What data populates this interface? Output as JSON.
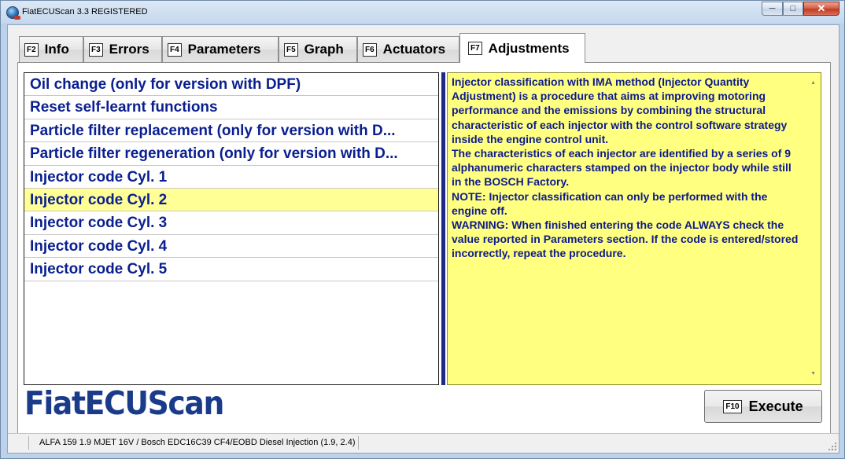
{
  "window": {
    "title": "FiatECUScan 3.3 REGISTERED",
    "caption_buttons": {
      "minimize": "─",
      "maximize": "□",
      "close": "✕"
    }
  },
  "tabs": [
    {
      "key": "F2",
      "label": "Info"
    },
    {
      "key": "F3",
      "label": "Errors"
    },
    {
      "key": "F4",
      "label": "Parameters"
    },
    {
      "key": "F5",
      "label": "Graph"
    },
    {
      "key": "F6",
      "label": "Actuators"
    },
    {
      "key": "F7",
      "label": "Adjustments",
      "active": true
    }
  ],
  "adjustments": {
    "items": [
      "Oil change (only for version with DPF)",
      "Reset self-learnt functions",
      "Particle filter replacement (only for version with D...",
      "Particle filter regeneration (only for version with D...",
      "Injector code Cyl. 1",
      "Injector code Cyl. 2",
      "Injector code Cyl. 3",
      "Injector code Cyl. 4",
      "Injector code Cyl. 5"
    ],
    "selected_index": 5,
    "description": [
      "Injector classification with IMA method (Injector Quantity Adjustment) is a procedure that aims at improving motoring performance and the emissions by combining the structural characteristic of each injector with the control software strategy inside the engine control unit.",
      "The characteristics of each injector are identified by a series of 9 alphanumeric characters stamped on the injector body while still in the BOSCH Factory.",
      "NOTE: Injector classification can only be performed with the engine off.",
      "WARNING: When finished entering the code ALWAYS check the value reported in Parameters section. If the code is entered/stored incorrectly, repeat the procedure."
    ]
  },
  "logo": {
    "text": "FiatECUScan"
  },
  "execute_button": {
    "key": "F10",
    "label": "Execute"
  },
  "statusbar": {
    "text": "ALFA 159 1.9 MJET 16V / Bosch EDC16C39 CF4/EOBD Diesel Injection (1.9, 2.4)"
  },
  "colors": {
    "selected_row": "#ffff96",
    "description_bg": "#ffff80",
    "item_text": "#0a1f8f",
    "logo": "#1a3a8a"
  }
}
